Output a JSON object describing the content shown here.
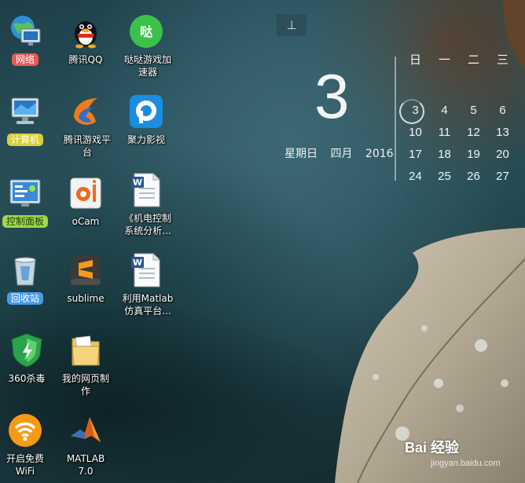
{
  "desktop_icons": [
    {
      "label": "网络",
      "icon": "network-globe-icon",
      "tag_color": "#e8585a"
    },
    {
      "label": "腾讯QQ",
      "icon": "qq-penguin-icon"
    },
    {
      "label": "哒哒游戏加速器",
      "icon": "dada-game-accelerator-icon"
    },
    {
      "label": "计算机",
      "icon": "computer-monitor-icon",
      "tag_color": "#d9cf3a"
    },
    {
      "label": "腾讯游戏平台",
      "icon": "tencent-games-flame-icon"
    },
    {
      "label": "聚力影视",
      "icon": "pptv-player-icon"
    },
    {
      "label": "控制面板",
      "icon": "control-panel-icon",
      "tag_color": "#9fd84a"
    },
    {
      "label": "oCam",
      "icon": "ocam-camera-icon"
    },
    {
      "label": "《机电控制系统分析...",
      "icon": "word-document-icon"
    },
    {
      "label": "回收站",
      "icon": "recycle-bin-icon",
      "tag_color": "#4a9be8"
    },
    {
      "label": "sublime",
      "icon": "sublime-text-icon"
    },
    {
      "label": "利用Matlab仿真平台...",
      "icon": "word-document-icon"
    },
    {
      "label": "360杀毒",
      "icon": "shield-antivirus-icon"
    },
    {
      "label": "我的网页制作",
      "icon": "folder-icon"
    },
    {
      "label": "开启免费WiFi",
      "icon": "wifi-icon"
    },
    {
      "label": "MATLAB 7.0",
      "icon": "matlab-icon"
    }
  ],
  "calendar_gadget": {
    "pin": "⊥",
    "day": "3",
    "weekday": "星期日",
    "month": "四月",
    "year": "2016",
    "headers": [
      "日",
      "一",
      "二",
      "三"
    ],
    "rows": [
      [
        "3",
        "4",
        "5",
        "6"
      ],
      [
        "10",
        "11",
        "12",
        "13"
      ],
      [
        "17",
        "18",
        "19",
        "20"
      ],
      [
        "24",
        "25",
        "26",
        "27"
      ]
    ],
    "today": "3"
  },
  "watermark": {
    "text": "Bai 经验",
    "sub": "jingyan.baidu.com"
  }
}
